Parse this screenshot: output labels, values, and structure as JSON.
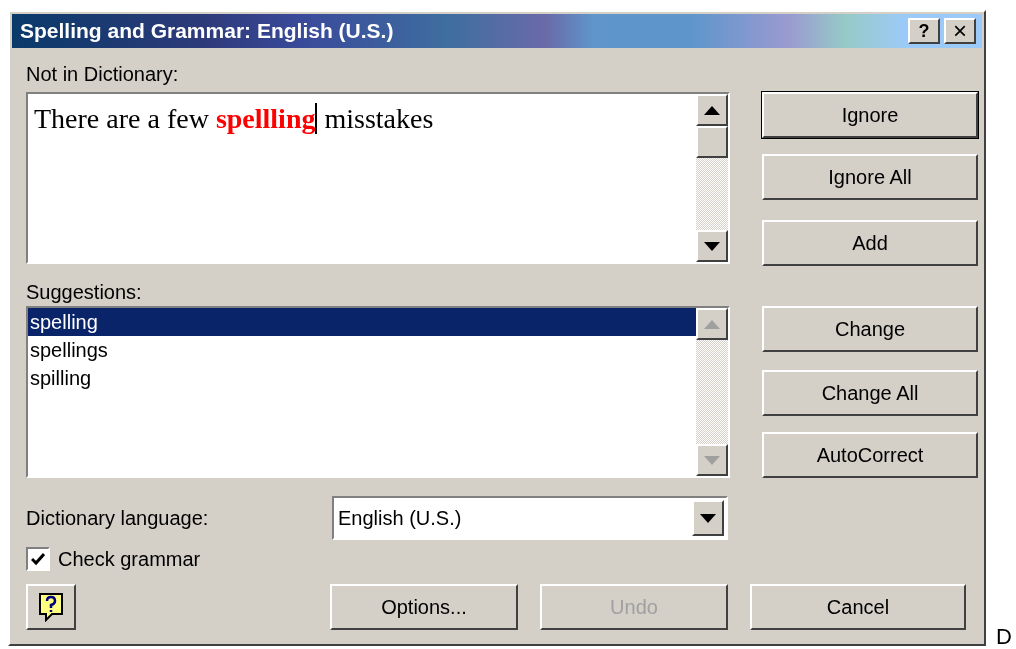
{
  "window": {
    "title": "Spelling and Grammar: English (U.S.)",
    "help_glyph": "?",
    "close_glyph": "×"
  },
  "not_in_dictionary": {
    "label": "Not in Dictionary:",
    "scrollbar_disabled": false,
    "segments": [
      {
        "text": "There are a few ",
        "flagged": false
      },
      {
        "text": "spellling",
        "flagged": true
      },
      {
        "text": " misstakes",
        "flagged": false
      }
    ]
  },
  "suggestions": {
    "label": "Suggestions:",
    "scrollbar_disabled": true,
    "items": [
      {
        "text": "spelling",
        "selected": true
      },
      {
        "text": "spellings",
        "selected": false
      },
      {
        "text": "spilling",
        "selected": false
      }
    ]
  },
  "dictionary_language": {
    "label": "Dictionary language:",
    "value": "English (U.S.)"
  },
  "check_grammar": {
    "label": "Check grammar",
    "checked": true
  },
  "side_buttons": [
    {
      "label": "Ignore",
      "default": true
    },
    {
      "label": "Ignore All",
      "default": false
    },
    {
      "label": "Add",
      "default": false
    },
    {
      "label": "Change",
      "default": false
    },
    {
      "label": "Change All",
      "default": false
    },
    {
      "label": "AutoCorrect",
      "default": false
    }
  ],
  "bottom_buttons": [
    {
      "label": "Options...",
      "disabled": false
    },
    {
      "label": "Undo",
      "disabled": true
    },
    {
      "label": "Cancel",
      "disabled": false
    }
  ],
  "stray_text": "D"
}
